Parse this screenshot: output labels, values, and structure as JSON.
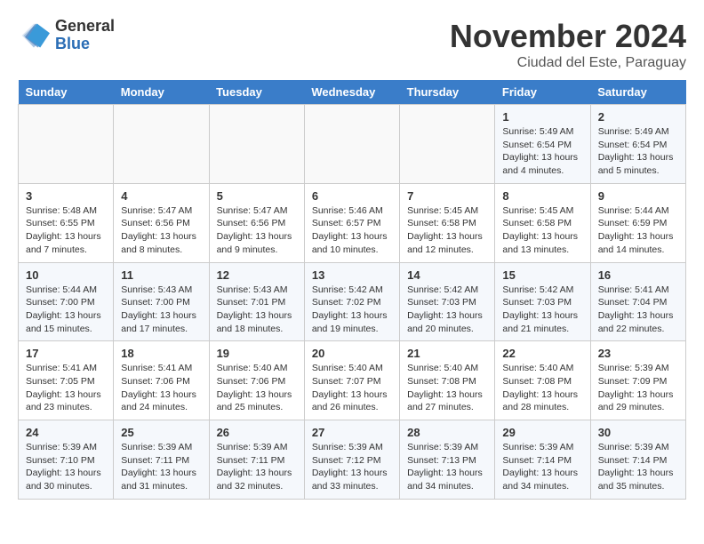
{
  "logo": {
    "general": "General",
    "blue": "Blue"
  },
  "title": "November 2024",
  "subtitle": "Ciudad del Este, Paraguay",
  "headers": [
    "Sunday",
    "Monday",
    "Tuesday",
    "Wednesday",
    "Thursday",
    "Friday",
    "Saturday"
  ],
  "weeks": [
    [
      {
        "day": "",
        "info": ""
      },
      {
        "day": "",
        "info": ""
      },
      {
        "day": "",
        "info": ""
      },
      {
        "day": "",
        "info": ""
      },
      {
        "day": "",
        "info": ""
      },
      {
        "day": "1",
        "info": "Sunrise: 5:49 AM\nSunset: 6:54 PM\nDaylight: 13 hours\nand 4 minutes."
      },
      {
        "day": "2",
        "info": "Sunrise: 5:49 AM\nSunset: 6:54 PM\nDaylight: 13 hours\nand 5 minutes."
      }
    ],
    [
      {
        "day": "3",
        "info": "Sunrise: 5:48 AM\nSunset: 6:55 PM\nDaylight: 13 hours\nand 7 minutes."
      },
      {
        "day": "4",
        "info": "Sunrise: 5:47 AM\nSunset: 6:56 PM\nDaylight: 13 hours\nand 8 minutes."
      },
      {
        "day": "5",
        "info": "Sunrise: 5:47 AM\nSunset: 6:56 PM\nDaylight: 13 hours\nand 9 minutes."
      },
      {
        "day": "6",
        "info": "Sunrise: 5:46 AM\nSunset: 6:57 PM\nDaylight: 13 hours\nand 10 minutes."
      },
      {
        "day": "7",
        "info": "Sunrise: 5:45 AM\nSunset: 6:58 PM\nDaylight: 13 hours\nand 12 minutes."
      },
      {
        "day": "8",
        "info": "Sunrise: 5:45 AM\nSunset: 6:58 PM\nDaylight: 13 hours\nand 13 minutes."
      },
      {
        "day": "9",
        "info": "Sunrise: 5:44 AM\nSunset: 6:59 PM\nDaylight: 13 hours\nand 14 minutes."
      }
    ],
    [
      {
        "day": "10",
        "info": "Sunrise: 5:44 AM\nSunset: 7:00 PM\nDaylight: 13 hours\nand 15 minutes."
      },
      {
        "day": "11",
        "info": "Sunrise: 5:43 AM\nSunset: 7:00 PM\nDaylight: 13 hours\nand 17 minutes."
      },
      {
        "day": "12",
        "info": "Sunrise: 5:43 AM\nSunset: 7:01 PM\nDaylight: 13 hours\nand 18 minutes."
      },
      {
        "day": "13",
        "info": "Sunrise: 5:42 AM\nSunset: 7:02 PM\nDaylight: 13 hours\nand 19 minutes."
      },
      {
        "day": "14",
        "info": "Sunrise: 5:42 AM\nSunset: 7:03 PM\nDaylight: 13 hours\nand 20 minutes."
      },
      {
        "day": "15",
        "info": "Sunrise: 5:42 AM\nSunset: 7:03 PM\nDaylight: 13 hours\nand 21 minutes."
      },
      {
        "day": "16",
        "info": "Sunrise: 5:41 AM\nSunset: 7:04 PM\nDaylight: 13 hours\nand 22 minutes."
      }
    ],
    [
      {
        "day": "17",
        "info": "Sunrise: 5:41 AM\nSunset: 7:05 PM\nDaylight: 13 hours\nand 23 minutes."
      },
      {
        "day": "18",
        "info": "Sunrise: 5:41 AM\nSunset: 7:06 PM\nDaylight: 13 hours\nand 24 minutes."
      },
      {
        "day": "19",
        "info": "Sunrise: 5:40 AM\nSunset: 7:06 PM\nDaylight: 13 hours\nand 25 minutes."
      },
      {
        "day": "20",
        "info": "Sunrise: 5:40 AM\nSunset: 7:07 PM\nDaylight: 13 hours\nand 26 minutes."
      },
      {
        "day": "21",
        "info": "Sunrise: 5:40 AM\nSunset: 7:08 PM\nDaylight: 13 hours\nand 27 minutes."
      },
      {
        "day": "22",
        "info": "Sunrise: 5:40 AM\nSunset: 7:08 PM\nDaylight: 13 hours\nand 28 minutes."
      },
      {
        "day": "23",
        "info": "Sunrise: 5:39 AM\nSunset: 7:09 PM\nDaylight: 13 hours\nand 29 minutes."
      }
    ],
    [
      {
        "day": "24",
        "info": "Sunrise: 5:39 AM\nSunset: 7:10 PM\nDaylight: 13 hours\nand 30 minutes."
      },
      {
        "day": "25",
        "info": "Sunrise: 5:39 AM\nSunset: 7:11 PM\nDaylight: 13 hours\nand 31 minutes."
      },
      {
        "day": "26",
        "info": "Sunrise: 5:39 AM\nSunset: 7:11 PM\nDaylight: 13 hours\nand 32 minutes."
      },
      {
        "day": "27",
        "info": "Sunrise: 5:39 AM\nSunset: 7:12 PM\nDaylight: 13 hours\nand 33 minutes."
      },
      {
        "day": "28",
        "info": "Sunrise: 5:39 AM\nSunset: 7:13 PM\nDaylight: 13 hours\nand 34 minutes."
      },
      {
        "day": "29",
        "info": "Sunrise: 5:39 AM\nSunset: 7:14 PM\nDaylight: 13 hours\nand 34 minutes."
      },
      {
        "day": "30",
        "info": "Sunrise: 5:39 AM\nSunset: 7:14 PM\nDaylight: 13 hours\nand 35 minutes."
      }
    ]
  ]
}
